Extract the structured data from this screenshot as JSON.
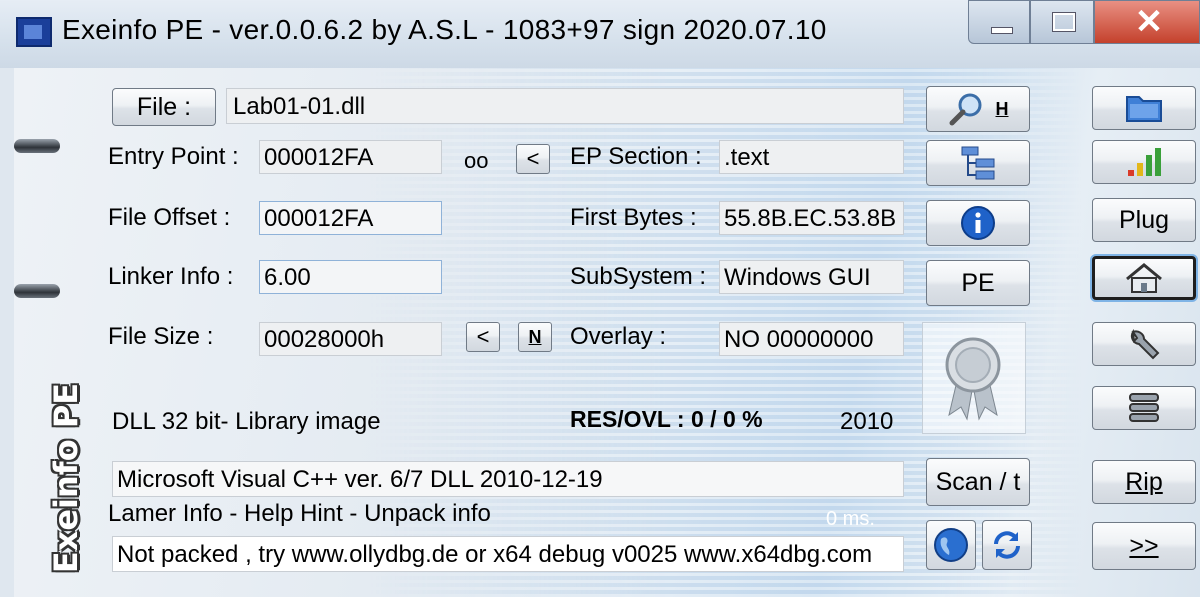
{
  "window": {
    "title": "Exeinfo PE - ver.0.0.6.2  by A.S.L -  1083+97 sign  2020.07.10",
    "close_glyph": "✕"
  },
  "file": {
    "button_label": "File :",
    "path": "Lab01-01.dll"
  },
  "fields": {
    "entry_point_label": "Entry Point :",
    "entry_point": "000012FA",
    "oo_label": "oo",
    "lt_label": "<",
    "ep_section_label": "EP Section :",
    "ep_section": ".text",
    "file_offset_label": "File Offset :",
    "file_offset": "000012FA",
    "first_bytes_label": "First Bytes :",
    "first_bytes": "55.8B.EC.53.8B",
    "linker_info_label": "Linker Info :",
    "linker_info": "6.00",
    "subsystem_label": "SubSystem :",
    "subsystem": "Windows GUI",
    "file_size_label": "File Size :",
    "file_size": "00028000h",
    "n_label": "N",
    "overlay_label": "Overlay :",
    "overlay": "NO   00000000"
  },
  "info": {
    "dll_desc": "DLL 32 bit- Library image",
    "res_ovl": "RES/OVL : 0 / 0 %",
    "year": "2010",
    "detection": "Microsoft Visual C++ ver. 6/7 DLL   2010-12-19",
    "lamer_info": "Lamer Info - Help Hint - Unpack info",
    "timing": "0 ms.",
    "hint": "Not packed , try  www.ollydbg.de or x64 debug v0025 www.x64dbg.com"
  },
  "middle_buttons": {
    "search_h_label": "H",
    "pe_label": "PE",
    "scan_label": "Scan / t"
  },
  "right_buttons": {
    "plug_label": "Plug",
    "rip_label": "Rip",
    "more_label": ">>"
  },
  "side_logo_text": "Exeinfo PE",
  "colors": {
    "accent_blue": "#1f62c9",
    "close_red": "#c4412c",
    "bar_red": "#d93b2a",
    "bar_yellow": "#e3b719",
    "bar_green": "#3aa03a"
  },
  "icons": [
    "app-icon",
    "minimize-icon",
    "maximize-icon",
    "close-icon",
    "magnifier-icon",
    "tree-structure-icon",
    "info-icon",
    "ribbon-badge-icon",
    "globe-icon",
    "refresh-arrows-icon",
    "folder-icon",
    "signal-bars-icon",
    "home-icon",
    "wrench-icon",
    "stack-icon"
  ]
}
